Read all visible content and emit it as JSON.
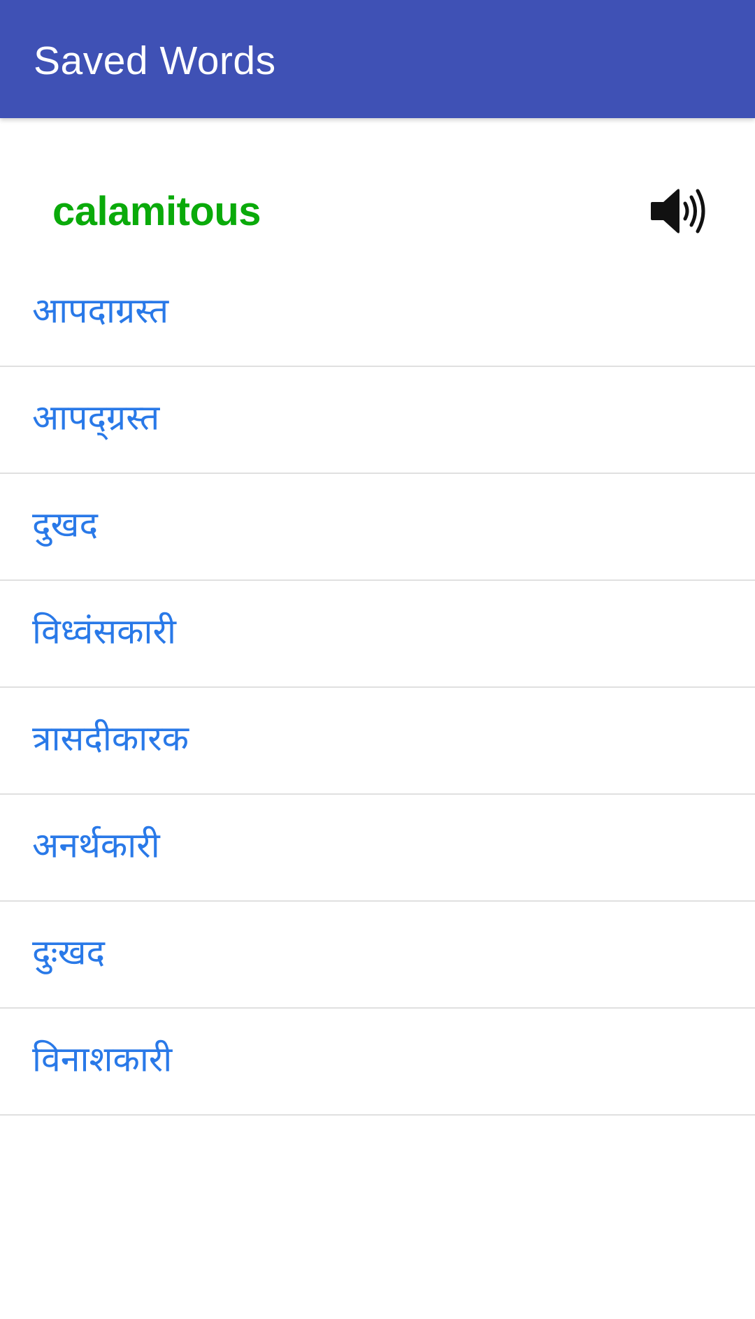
{
  "app_bar": {
    "title": "Saved Words",
    "background_color": "#3F51B5",
    "title_color": "#FFFFFF"
  },
  "word": {
    "text": "calamitous",
    "color": "#0AAA0A",
    "pronounce_icon": "speaker-volume-icon"
  },
  "meanings": {
    "color": "#2979E8",
    "items": [
      {
        "text": "आपदाग्रस्त"
      },
      {
        "text": "आपद्ग्रस्त"
      },
      {
        "text": "दुखद"
      },
      {
        "text": "विध्वंसकारी"
      },
      {
        "text": "त्रासदीकारक"
      },
      {
        "text": "अनर्थकारी"
      },
      {
        "text": "दुःखद"
      },
      {
        "text": "विनाशकारी"
      }
    ]
  }
}
